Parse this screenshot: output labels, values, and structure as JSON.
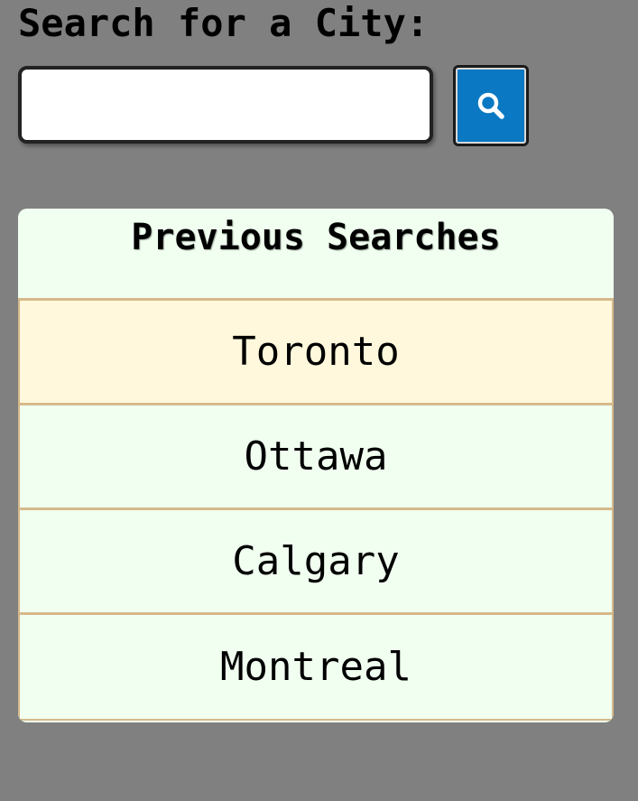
{
  "search": {
    "heading": "Search for a City:",
    "input_value": "",
    "button_icon": "search-icon"
  },
  "history": {
    "title": "Previous Searches",
    "items": [
      {
        "label": "Toronto",
        "active": true
      },
      {
        "label": "Ottawa",
        "active": false
      },
      {
        "label": "Calgary",
        "active": false
      },
      {
        "label": "Montreal",
        "active": false
      }
    ]
  },
  "colors": {
    "page_background": "#808080",
    "button_background": "#0a78c2",
    "panel_background": "#f0fff0",
    "active_item_background": "#fff8dc",
    "border_tan": "#d6b98a"
  }
}
